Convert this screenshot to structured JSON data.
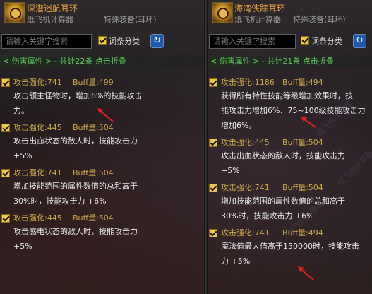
{
  "left": {
    "title": "深潜迷航耳环",
    "subtitle": "纸飞机计算器",
    "category": "特殊装备(耳环)",
    "search_placeholder": "请输入关键字搜索",
    "checkbox_label": "词条分类",
    "group_header": "< 伤害属性 > - 共计22条 点击折叠",
    "entries": [
      {
        "enh": "攻击强化:741",
        "buff": "Buff量:499",
        "lines": [
          "攻击领主怪物时，增加6%的技能攻击",
          "力。"
        ]
      },
      {
        "enh": "攻击强化:445",
        "buff": "Buff量:504",
        "lines": [
          "攻击出血状态的敌人时，技能攻击力",
          "+5%"
        ]
      },
      {
        "enh": "攻击强化:741",
        "buff": "Buff量:504",
        "lines": [
          "增加技能范围的属性数值的总和高于",
          "30%时，技能攻击力 +6%"
        ]
      },
      {
        "enh": "攻击强化:445",
        "buff": "Buff量:504",
        "lines": [
          "攻击感电状态的敌人时，技能攻击力",
          "+5%"
        ]
      }
    ]
  },
  "right": {
    "title": "海湾侠踪耳环",
    "subtitle": "纸飞机计算器",
    "category": "特殊装备(耳环)",
    "search_placeholder": "请输入关键字搜索",
    "checkbox_label": "词条分类",
    "group_header": "< 伤害属性 > - 共计21条 点击折叠",
    "entries": [
      {
        "enh": "攻击强化:1186",
        "buff": "Buff量:494",
        "lines": [
          "获得所有特性技能等级增加效果时，技",
          "能攻击力增加6%、75~100级技能攻击力",
          "增加6%。"
        ]
      },
      {
        "enh": "攻击强化:445",
        "buff": "Buff量:504",
        "lines": [
          "攻击出血状态的敌人时，技能攻击力",
          "+5%"
        ]
      },
      {
        "enh": "攻击强化:741",
        "buff": "Buff量:504",
        "lines": [
          "增加技能范围的属性数值的总和高于",
          "30%时，技能攻击力 +6%"
        ]
      },
      {
        "enh": "攻击强化:741",
        "buff": "Buff量:494",
        "lines": [
          "魔法值最大值高于150000时，技能攻击",
          "力 +5%"
        ]
      }
    ]
  },
  "watermark": "纸飞机计算器",
  "colors": {
    "title": "#e8a040",
    "buff": "#c9a64a",
    "group": "#5cc85c",
    "arrow": "#e02020"
  },
  "icons": {
    "refresh": "refresh-icon",
    "item": "earring-icon"
  }
}
